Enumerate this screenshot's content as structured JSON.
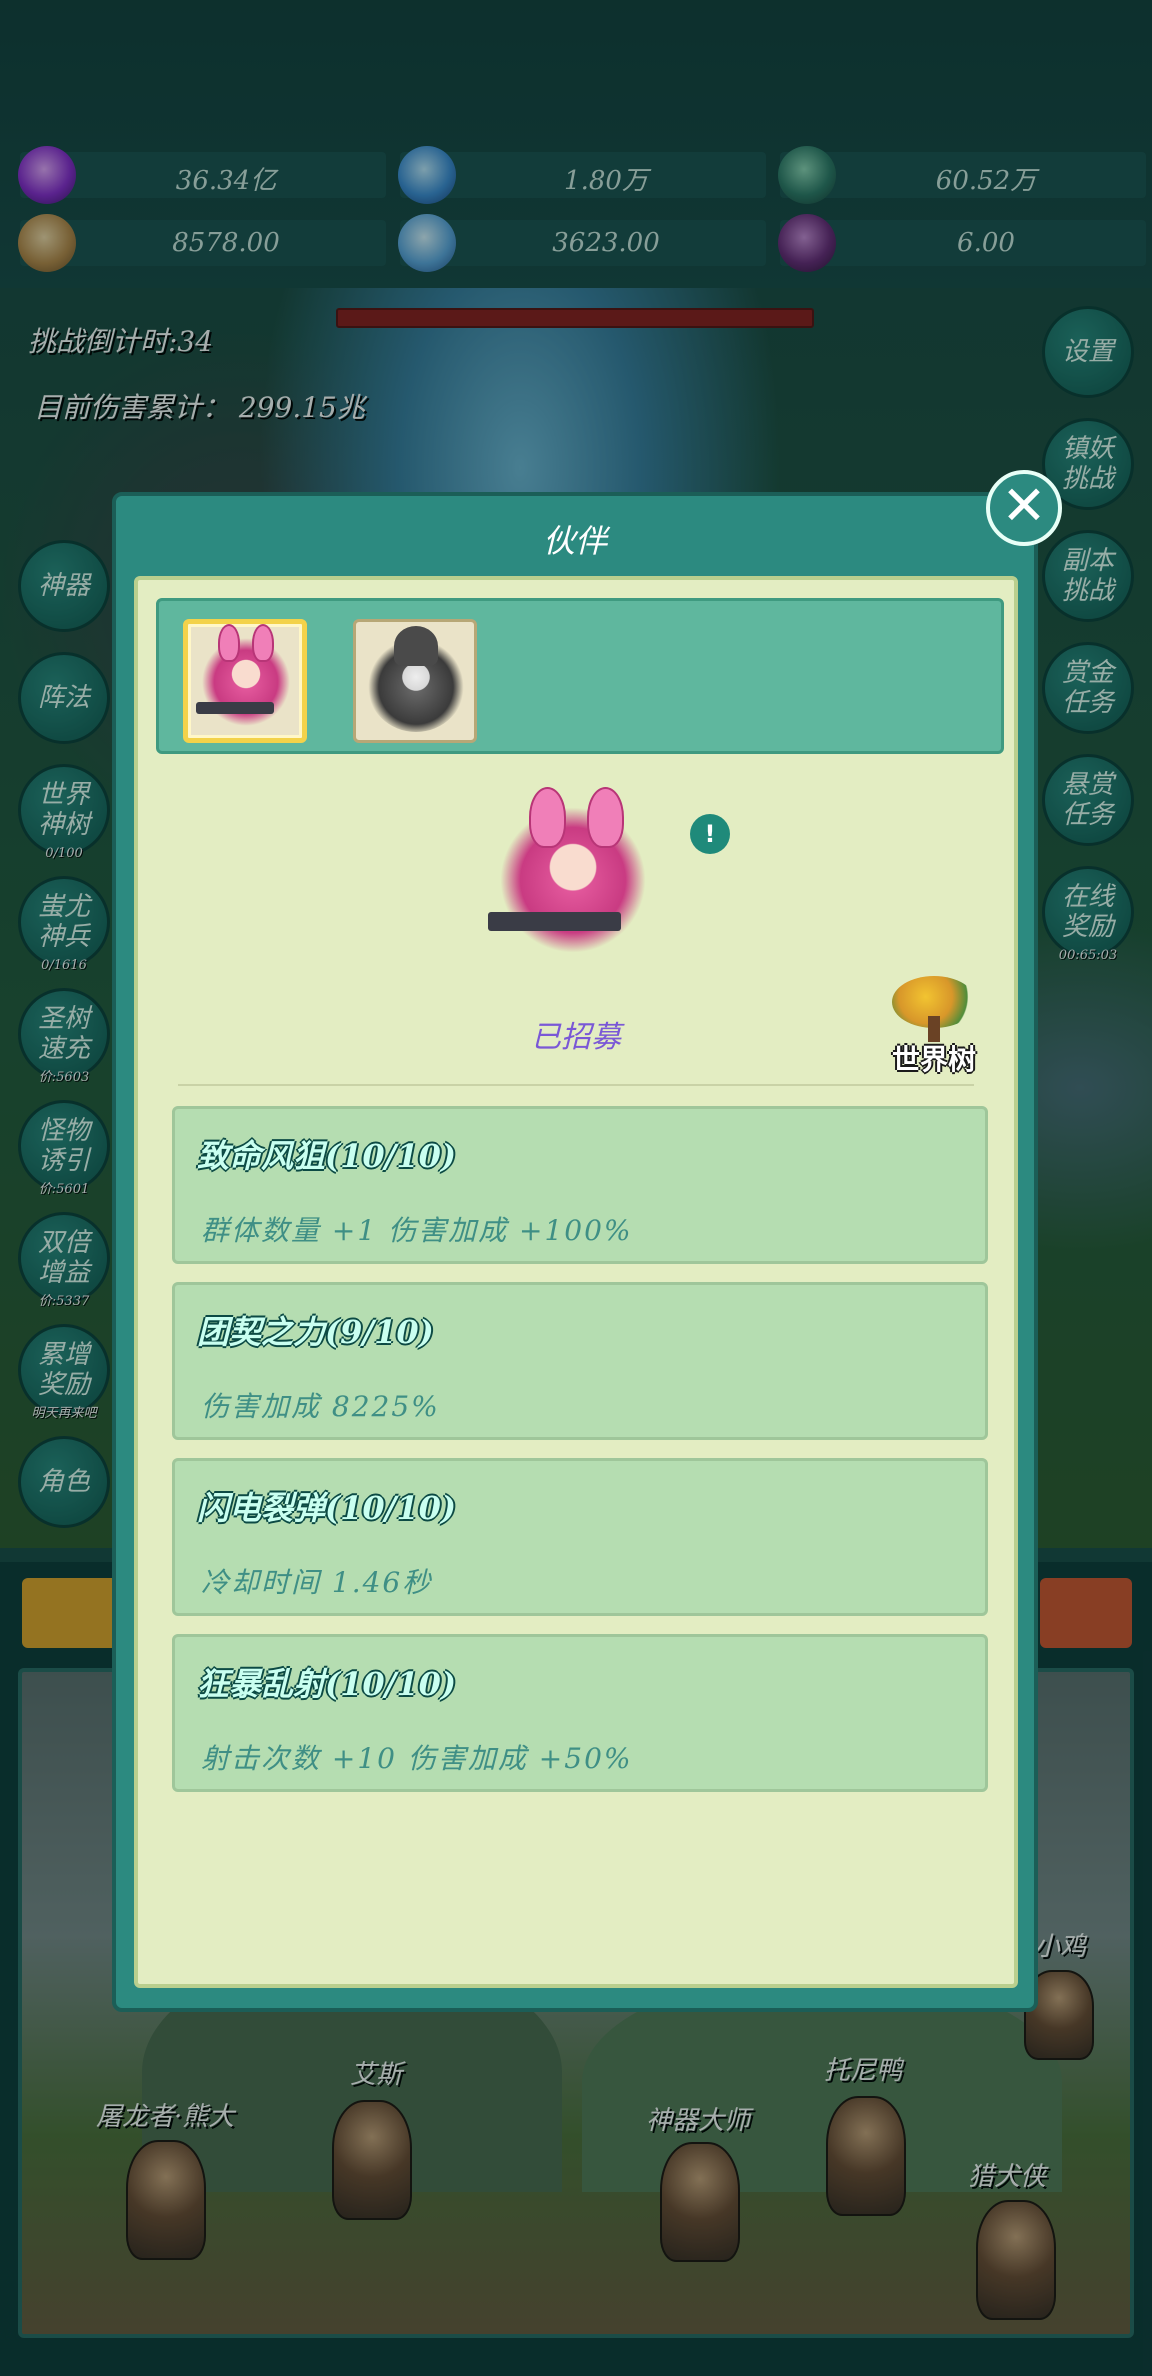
{
  "resources": [
    {
      "icon": "purple-gem-icon",
      "value": "36.34亿"
    },
    {
      "icon": "blue-crystal-icon",
      "value": "1.80万"
    },
    {
      "icon": "world-orb-icon",
      "value": "60.52万"
    },
    {
      "icon": "scroll-icon",
      "value": "8578.00"
    },
    {
      "icon": "ice-cube-icon",
      "value": "3623.00"
    },
    {
      "icon": "mangosteen-icon",
      "value": "6.00"
    }
  ],
  "hud": {
    "countdown": "挑战倒计时:34",
    "damage": "目前伤害累计：  299.15兆"
  },
  "left_buttons": [
    {
      "label": "神器",
      "caption": ""
    },
    {
      "label": "阵法",
      "caption": ""
    },
    {
      "label": "世界神树",
      "caption": "0/100"
    },
    {
      "label": "蚩尤神兵",
      "caption": "0/1616"
    },
    {
      "label": "圣树速充",
      "caption": "价:5603"
    },
    {
      "label": "怪物诱引",
      "caption": "价:5601"
    },
    {
      "label": "双倍增益",
      "caption": "价:5337"
    },
    {
      "label": "累增奖励",
      "caption": "明天再来吧"
    },
    {
      "label": "角色",
      "caption": ""
    }
  ],
  "right_buttons": [
    {
      "label": "设置",
      "caption": ""
    },
    {
      "label": "镇妖挑战",
      "caption": ""
    },
    {
      "label": "副本挑战",
      "caption": ""
    },
    {
      "label": "赏金任务",
      "caption": ""
    },
    {
      "label": "悬赏任务",
      "caption": ""
    },
    {
      "label": "在线奖励",
      "caption": "00:65:03"
    }
  ],
  "characters": [
    {
      "name": "屠龙者·熊大"
    },
    {
      "name": "艾斯"
    },
    {
      "name": "神器大师"
    },
    {
      "name": "托尼鸭"
    },
    {
      "name": "小鸡"
    },
    {
      "name": "猎犬侠"
    }
  ],
  "modal": {
    "title": "伙伴",
    "close_symbol": "✕",
    "tabs": [
      {
        "icon": "pink-bunny-gunner-icon",
        "selected": true
      },
      {
        "icon": "gray-cat-mage-icon",
        "selected": false
      }
    ],
    "info_symbol": "!",
    "status": "已招募",
    "world_tree_label": "世界树",
    "skills": [
      {
        "title": "致命风狙(10/10)",
        "desc": "群体数量 +1  伤害加成 +100%"
      },
      {
        "title": "团契之力(9/10)",
        "desc": "伤害加成 8225%"
      },
      {
        "title": "闪电裂弹(10/10)",
        "desc": "冷却时间 1.46秒"
      },
      {
        "title": "狂暴乱射(10/10)",
        "desc": "射击次数 +10 伤害加成 +50%"
      }
    ]
  },
  "colors": {
    "panel_bg": "#e3edc2",
    "frame": "#2c8a80",
    "skill_bg": "#b5ddb1",
    "status": "#7a58d6"
  }
}
